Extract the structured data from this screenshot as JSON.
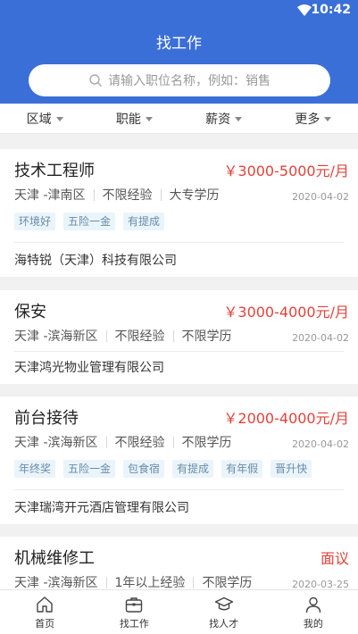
{
  "status_bar": {
    "time": "10:42",
    "wifi_icon": "wifi-icon"
  },
  "header": {
    "title": "找工作"
  },
  "search": {
    "placeholder": "请输入职位名称，例如：销售",
    "icon": "search-icon"
  },
  "filters": [
    {
      "label": "区域"
    },
    {
      "label": "职能"
    },
    {
      "label": "薪资"
    },
    {
      "label": "更多"
    }
  ],
  "jobs": [
    {
      "title": "技术工程师",
      "salary": "￥3000-5000元/月",
      "location": "天津 -津南区",
      "experience": "不限经验",
      "education": "大专学历",
      "date": "2020-04-02",
      "tags": [
        "环境好",
        "五险一金",
        "有提成"
      ],
      "company": "海特锐（天津）科技有限公司"
    },
    {
      "title": "保安",
      "salary": "￥3000-4000元/月",
      "location": "天津 -滨海新区",
      "experience": "不限经验",
      "education": "不限学历",
      "date": "2020-04-02",
      "tags": [],
      "company": "天津鸿光物业管理有限公司"
    },
    {
      "title": "前台接待",
      "salary": "￥2000-4000元/月",
      "location": "天津 -滨海新区",
      "experience": "不限经验",
      "education": "不限学历",
      "date": "2020-04-02",
      "tags": [
        "年终奖",
        "五险一金",
        "包食宿",
        "有提成",
        "有年假",
        "晋升快"
      ],
      "company": "天津瑞湾开元酒店管理有限公司"
    },
    {
      "title": "机械维修工",
      "salary": "面议",
      "location": "天津 -滨海新区",
      "experience": "1年以上经验",
      "education": "不限学历",
      "date": "2020-03-25"
    }
  ],
  "tabbar": [
    {
      "label": "首页",
      "icon": "home-icon"
    },
    {
      "label": "找工作",
      "icon": "briefcase-icon"
    },
    {
      "label": "找人才",
      "icon": "graduation-cap-icon"
    },
    {
      "label": "我的",
      "icon": "user-icon"
    }
  ],
  "colors": {
    "primary": "#3b6fd8",
    "salary": "#e0433b",
    "tag_bg": "#eaf4fb",
    "tag_text": "#6a8ba8"
  }
}
